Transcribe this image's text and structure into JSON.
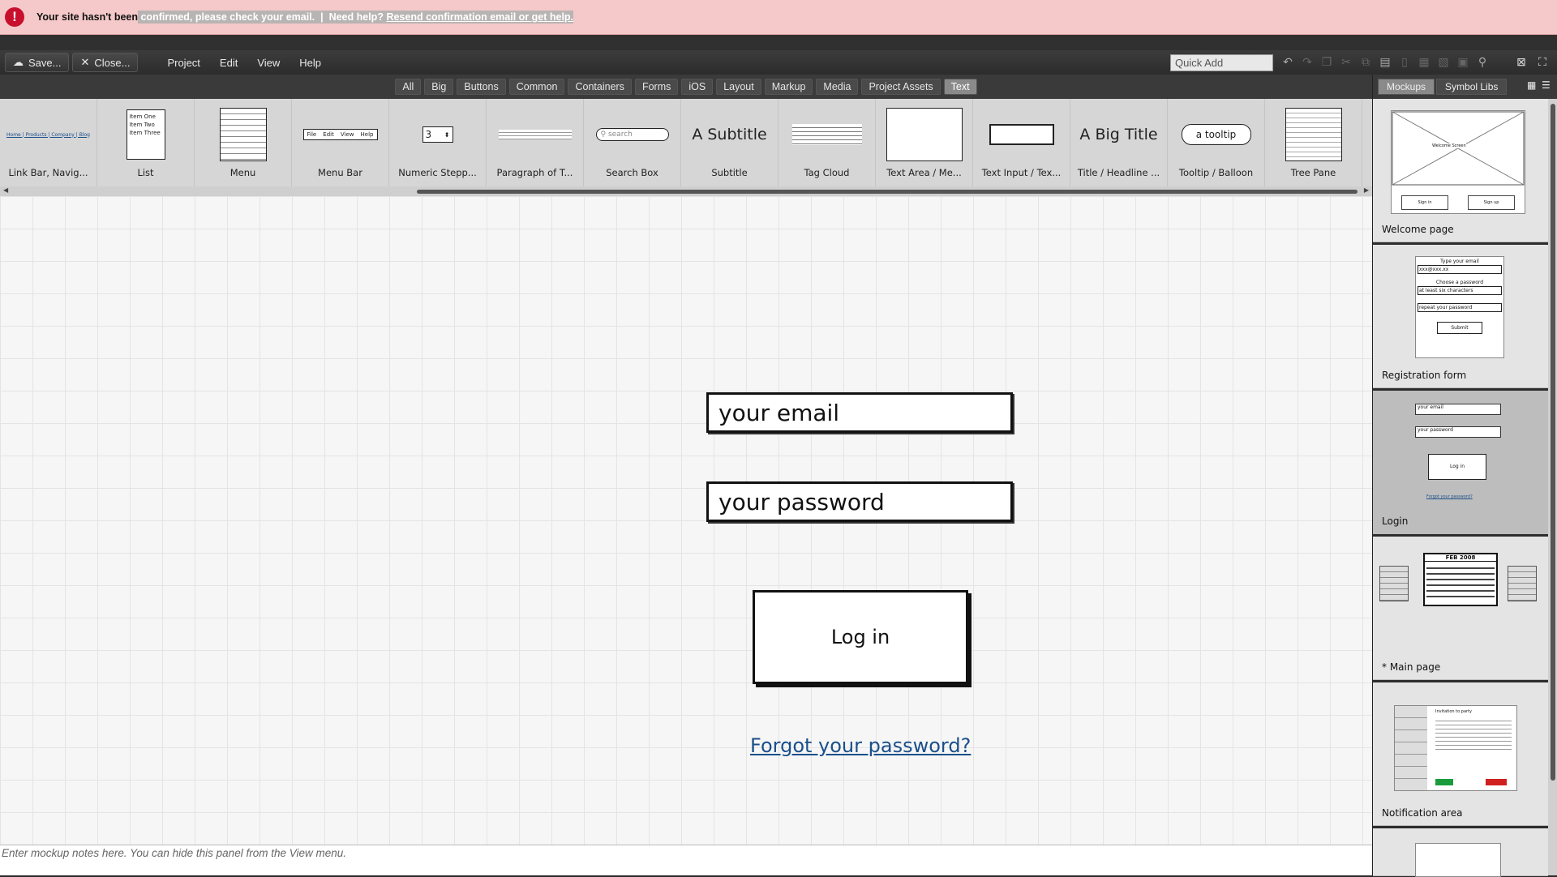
{
  "alert": {
    "icon": "exclamation-icon",
    "text_plain": "Your site hasn't been",
    "text_highlight": "confirmed, please check your email.",
    "separator": "|",
    "help_prefix": "Need help?",
    "help_link": "Resend confirmation email or get help."
  },
  "toolbar": {
    "save_label": "Save...",
    "close_label": "Close...",
    "menus": [
      "Project",
      "Edit",
      "View",
      "Help"
    ],
    "quick_add_placeholder": "Quick Add"
  },
  "filters": [
    "All",
    "Big",
    "Buttons",
    "Common",
    "Containers",
    "Forms",
    "iOS",
    "Layout",
    "Markup",
    "Media",
    "Project Assets",
    "Text"
  ],
  "active_filter": "Text",
  "library": [
    {
      "label": "Link Bar, Navig...",
      "thumb": "link-bar"
    },
    {
      "label": "List",
      "thumb": "list",
      "items": [
        "Item One",
        "Item Two",
        "Item Three"
      ]
    },
    {
      "label": "Menu",
      "thumb": "menu"
    },
    {
      "label": "Menu Bar",
      "thumb": "menu-bar",
      "items": [
        "File",
        "Edit",
        "View",
        "Help"
      ]
    },
    {
      "label": "Numeric Stepp...",
      "thumb": "stepper",
      "value": "3"
    },
    {
      "label": "Paragraph of T...",
      "thumb": "paragraph"
    },
    {
      "label": "Search Box",
      "thumb": "search",
      "placeholder": "search"
    },
    {
      "label": "Subtitle",
      "thumb": "subtitle",
      "text": "A Subtitle"
    },
    {
      "label": "Tag Cloud",
      "thumb": "tag-cloud"
    },
    {
      "label": "Text Area / Me...",
      "thumb": "text-area"
    },
    {
      "label": "Text Input / Tex...",
      "thumb": "text-input"
    },
    {
      "label": "Title / Headline ...",
      "thumb": "title",
      "text": "A Big Title"
    },
    {
      "label": "Tooltip / Balloon",
      "thumb": "tooltip",
      "text": "a tooltip"
    },
    {
      "label": "Tree Pane",
      "thumb": "tree"
    }
  ],
  "canvas": {
    "email_placeholder": "your email",
    "password_placeholder": "your password",
    "login_label": "Log in",
    "forgot_link": "Forgot your password?"
  },
  "notes_placeholder": "Enter mockup notes here. You can hide this panel from the View menu.",
  "right_panel": {
    "tabs": [
      "Mockups",
      "Symbol Libs"
    ],
    "active_tab": "Mockups",
    "mockups": [
      {
        "name": "Welcome page",
        "selected": false
      },
      {
        "name": "Registration form",
        "selected": false
      },
      {
        "name": "Login",
        "selected": true
      },
      {
        "name": "* Main page",
        "selected": false
      },
      {
        "name": "Notification area",
        "selected": false
      }
    ],
    "thumb_text": {
      "welcome_title": "Welcome Screen",
      "welcome_btn1": "Sign in",
      "welcome_btn2": "Sign up",
      "reg_email_label": "Type your email",
      "reg_email_value": "xxx@xxx.xx",
      "reg_pass_label": "Choose a password",
      "reg_pass_value": "at least six characters",
      "reg_repeat_value": "repeat your password",
      "reg_submit": "Submit",
      "login_email": "your email",
      "login_password": "your password",
      "login_button": "Log in",
      "login_forgot": "Forgot your password?",
      "main_calendar": "FEB 2008",
      "notif_title": "Invitation to party"
    }
  },
  "colors": {
    "alert_bg": "#f5c9c9",
    "alert_icon": "#c8102e",
    "link": "#1a4f8b",
    "canvas_bg": "#f6f6f6"
  }
}
